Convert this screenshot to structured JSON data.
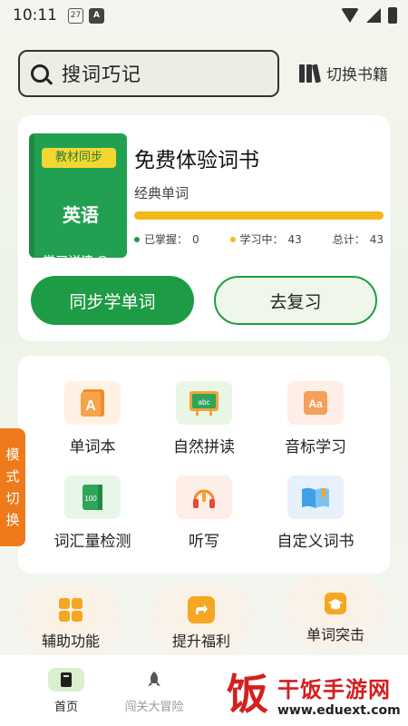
{
  "status_bar": {
    "time": "10:11",
    "calendar_day": "27",
    "notif_letter": "A"
  },
  "search": {
    "placeholder": "搜词巧记"
  },
  "header": {
    "switch_books_label": "切换书籍"
  },
  "book": {
    "cover_badge": "教材同步",
    "cover_subject": "英语",
    "cover_detail": "学习详情",
    "title": "免费体验词书",
    "subtitle": "经典单词",
    "progress_fraction": 1.0,
    "stats": {
      "mastered_label": "已掌握：",
      "mastered": "0",
      "learning_label": "学习中：",
      "learning": "43",
      "total_label": "总计：",
      "total": "43"
    },
    "colors": {
      "mastered": "#1e9b45",
      "learning": "#f4b71c",
      "cover": "#22a052"
    }
  },
  "actions": {
    "sync_label": "同步学单词",
    "review_label": "去复习"
  },
  "grid": [
    {
      "label": "单词本",
      "icon": "wordbook-icon"
    },
    {
      "label": "自然拼读",
      "icon": "phonics-board-icon"
    },
    {
      "label": "音标学习",
      "icon": "phonetic-aa-icon"
    },
    {
      "label": "词汇量检测",
      "icon": "vocab-test-icon"
    },
    {
      "label": "听写",
      "icon": "headphones-icon"
    },
    {
      "label": "自定义词书",
      "icon": "custom-book-icon"
    }
  ],
  "mode_tab": {
    "label_lines": [
      "模",
      "式",
      "切",
      "换"
    ]
  },
  "features": [
    {
      "label": "辅助功能",
      "icon": "grid-tiles-icon"
    },
    {
      "label": "提升福利",
      "icon": "share-arrow-icon"
    },
    {
      "label": "单词突击",
      "icon": "graduation-cap-icon"
    }
  ],
  "nav": [
    {
      "label": "首页",
      "icon": "book-home-icon",
      "active": true
    },
    {
      "label": "闯关大冒险",
      "icon": "rocket-icon",
      "active": false
    }
  ],
  "watermark": {
    "mark": "饭",
    "title": "干饭手游网",
    "url": "www.eduext.com"
  }
}
